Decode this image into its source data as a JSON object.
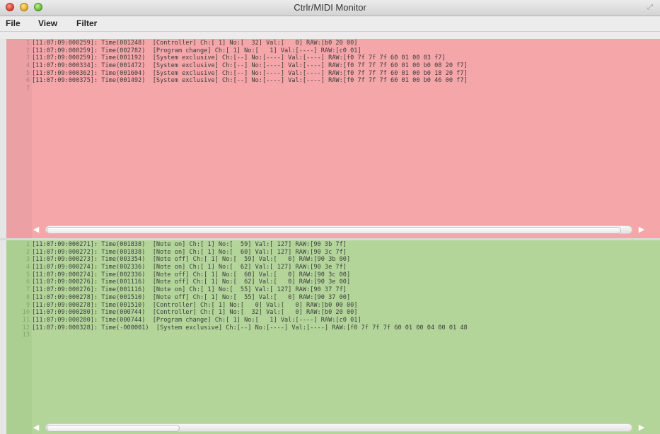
{
  "window": {
    "title": "Ctrlr/MIDI Monitor"
  },
  "menu": {
    "items": [
      "File",
      "View",
      "Filter"
    ]
  },
  "output_log": {
    "lines": [
      {
        "n": "1",
        "text": "[11:07:09:000259]: Time(001248)  [Controller] Ch:[ 1] No:[  32] Val:[   0] RAW:[b0 20 00]"
      },
      {
        "n": "2",
        "text": "[11:07:09:000259]: Time(002782)  [Program change] Ch:[ 1] No:[   1] Val:[----] RAW:[c0 01]"
      },
      {
        "n": "3",
        "text": "[11:07:09:000259]: Time(001192)  [System exclusive] Ch:[--] No:[----] Val:[----] RAW:[f0 7f 7f 7f 60 01 00 03 f7]"
      },
      {
        "n": "4",
        "text": "[11:07:09:000334]: Time(001472)  [System exclusive] Ch:[--] No:[----] Val:[----] RAW:[f0 7f 7f 7f 60 01 00 b0 08 20 f7]"
      },
      {
        "n": "5",
        "text": "[11:07:09:000362]: Time(001604)  [System exclusive] Ch:[--] No:[----] Val:[----] RAW:[f0 7f 7f 7f 60 01 00 b0 18 20 f7]"
      },
      {
        "n": "6",
        "text": "[11:07:09:000375]: Time(001492)  [System exclusive] Ch:[--] No:[----] Val:[----] RAW:[f0 7f 7f 7f 60 01 00 b0 46 00 f7]"
      },
      {
        "n": "7",
        "text": ""
      }
    ]
  },
  "input_log": {
    "lines": [
      {
        "n": "1",
        "text": "[11:07:09:000271]: Time(001838)  [Note on] Ch:[ 1] No:[  59] Val:[ 127] RAW:[90 3b 7f]"
      },
      {
        "n": "2",
        "text": "[11:07:09:000272]: Time(001838)  [Note on] Ch:[ 1] No:[  60] Val:[ 127] RAW:[90 3c 7f]"
      },
      {
        "n": "3",
        "text": "[11:07:09:000273]: Time(003354)  [Note off] Ch:[ 1] No:[  59] Val:[   0] RAW:[90 3b 00]"
      },
      {
        "n": "4",
        "text": "[11:07:09:000274]: Time(002336)  [Note on] Ch:[ 1] No:[  62] Val:[ 127] RAW:[90 3e 7f]"
      },
      {
        "n": "5",
        "text": "[11:07:09:000274]: Time(002336)  [Note off] Ch:[ 1] No:[  60] Val:[   0] RAW:[90 3c 00]"
      },
      {
        "n": "6",
        "text": "[11:07:09:000276]: Time(001116)  [Note off] Ch:[ 1] No:[  62] Val:[   0] RAW:[90 3e 00]"
      },
      {
        "n": "7",
        "text": "[11:07:09:000276]: Time(001116)  [Note on] Ch:[ 1] No:[  55] Val:[ 127] RAW:[90 37 7f]"
      },
      {
        "n": "8",
        "text": "[11:07:09:000278]: Time(001510)  [Note off] Ch:[ 1] No:[  55] Val:[   0] RAW:[90 37 00]"
      },
      {
        "n": "9",
        "text": "[11:07:09:000278]: Time(001510)  [Controller] Ch:[ 1] No:[   0] Val:[   0] RAW:[b0 00 00]"
      },
      {
        "n": "10",
        "text": "[11:07:09:000280]: Time(000744)  [Controller] Ch:[ 1] No:[  32] Val:[   0] RAW:[b0 20 00]"
      },
      {
        "n": "11",
        "text": "[11:07:09:000280]: Time(000744)  [Program change] Ch:[ 1] No:[   1] Val:[----] RAW:[c0 01]"
      },
      {
        "n": "12",
        "text": "[11:07:09:000328]: Time(-000001)  [System exclusive] Ch:[--] No:[----] Val:[----] RAW:[f0 7f 7f 7f 60 01 00 04 00 01 48"
      },
      {
        "n": "13",
        "text": ""
      }
    ]
  },
  "colors": {
    "output_bg": "#f4a6a9",
    "input_bg": "#b3d59a"
  }
}
